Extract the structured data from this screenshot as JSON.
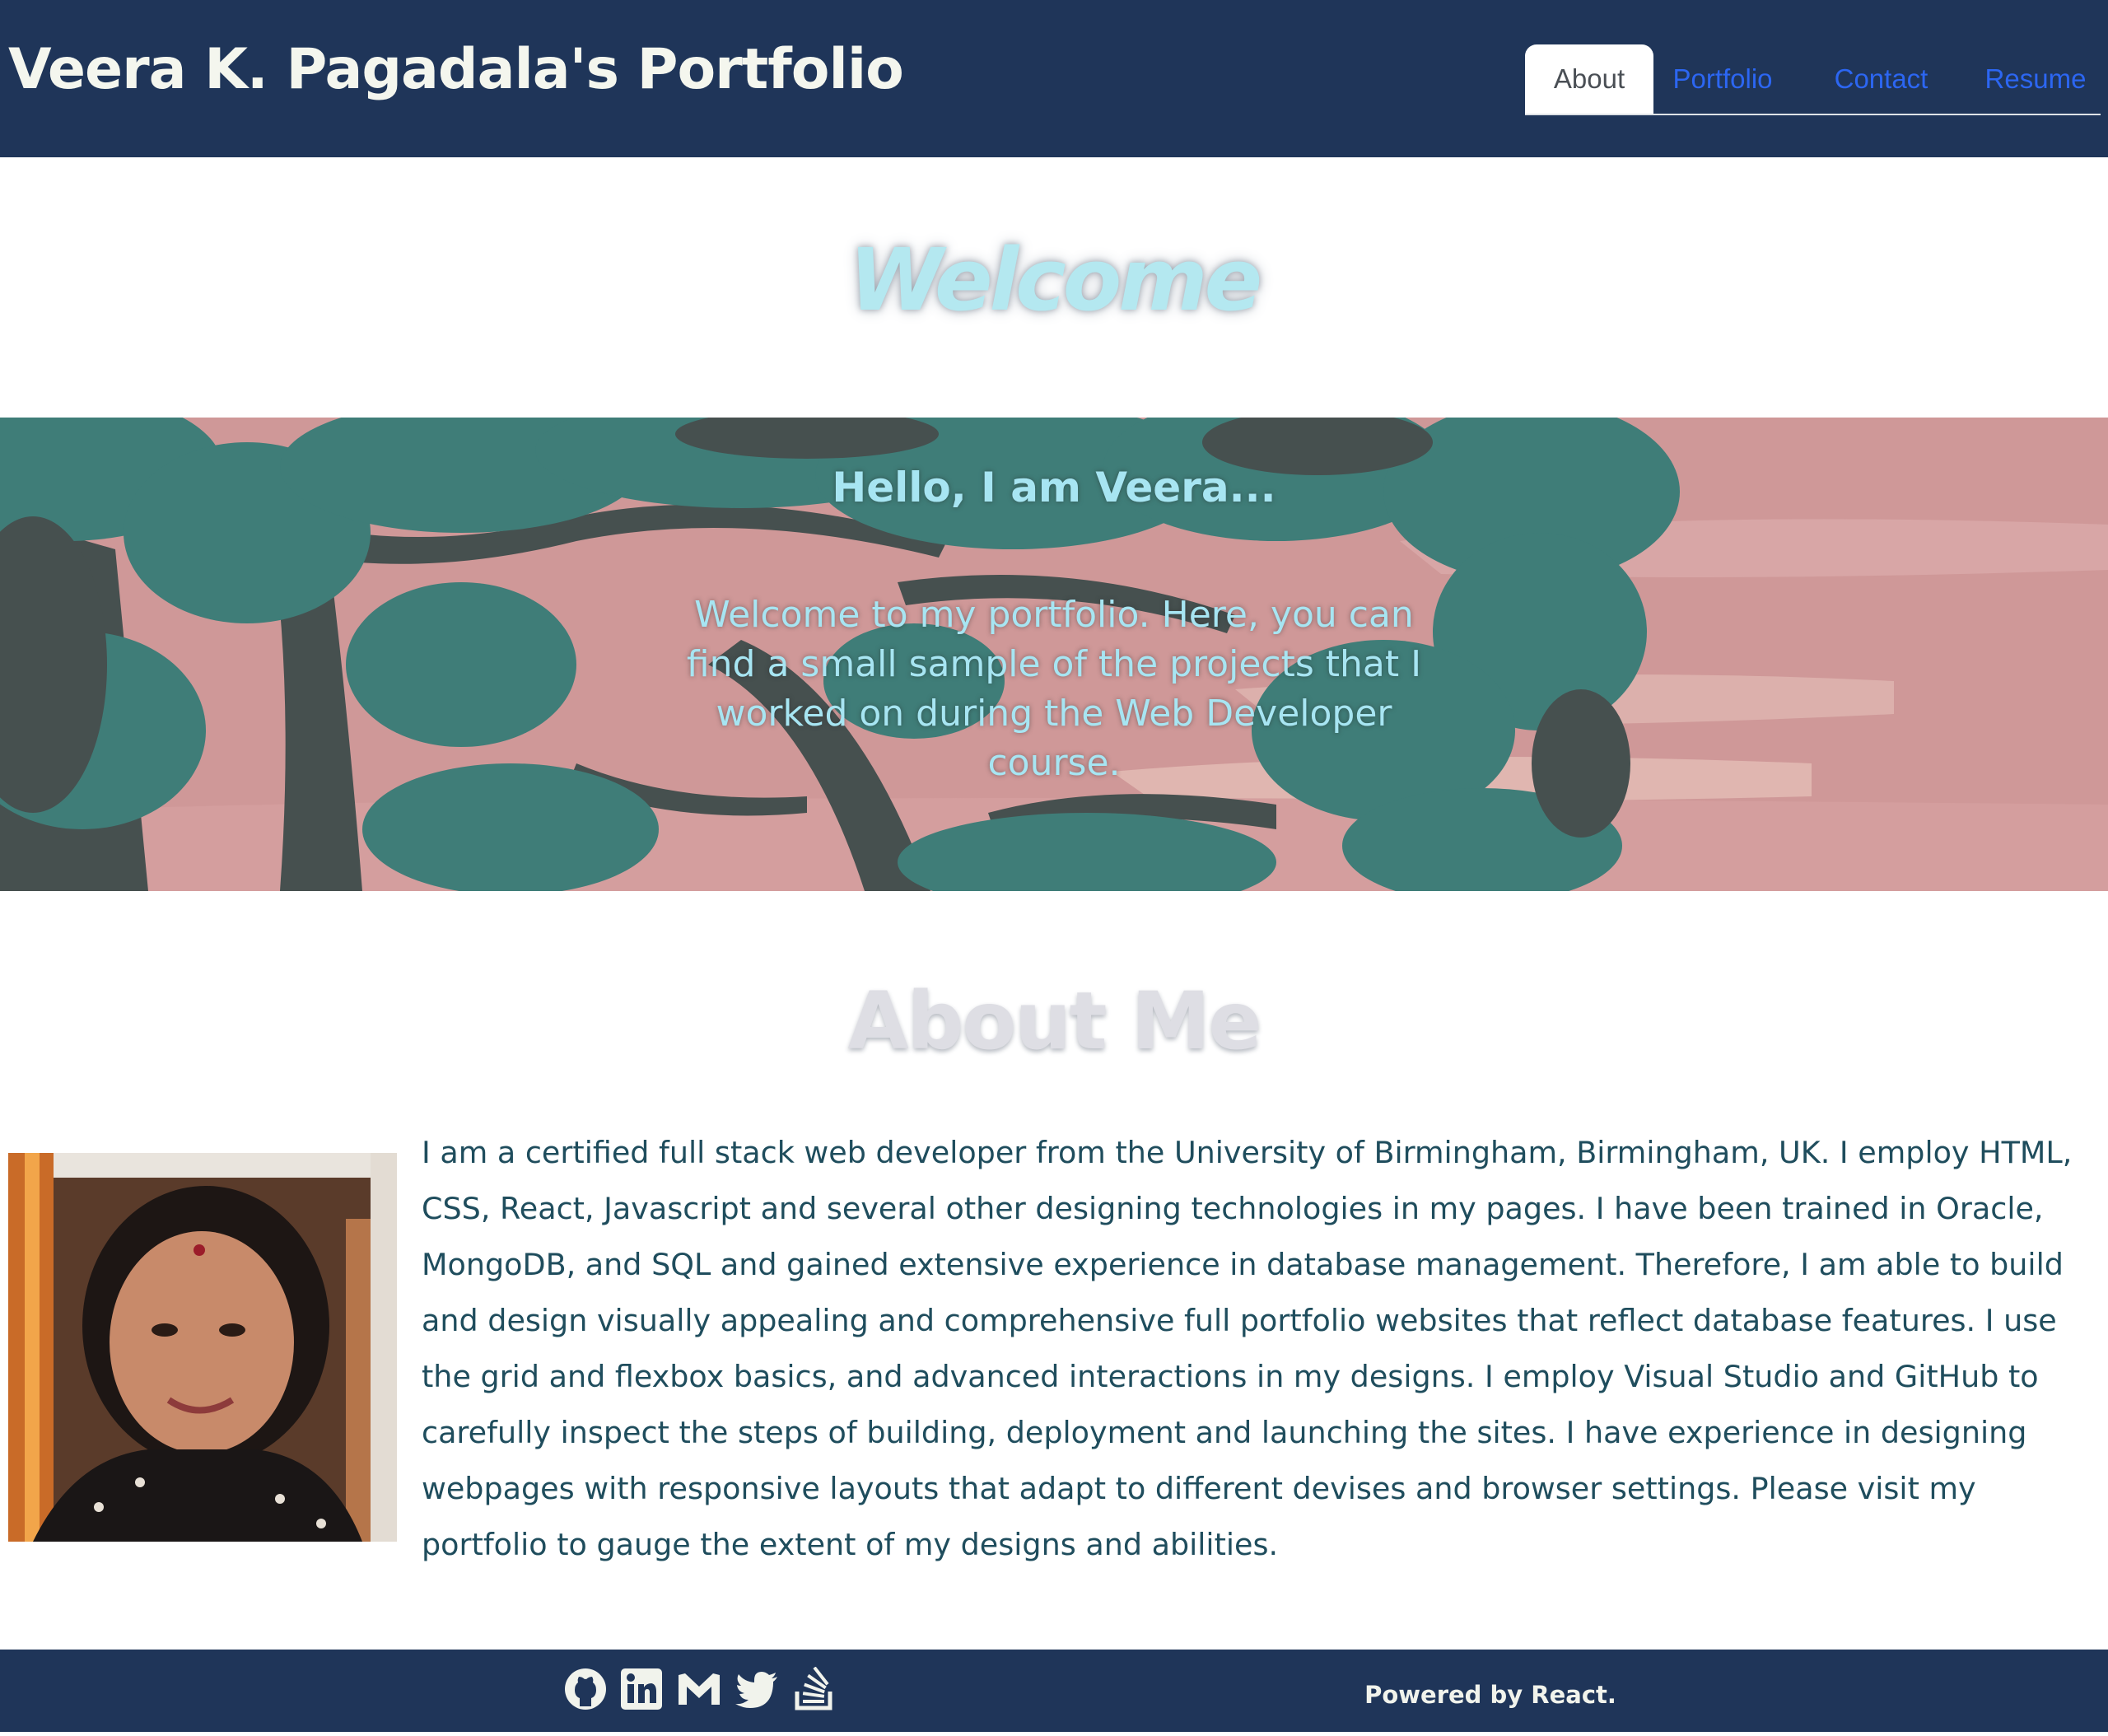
{
  "header": {
    "site_title": "Veera K. Pagadala's Portfolio",
    "nav": {
      "items": [
        {
          "label": "About",
          "active": true
        },
        {
          "label": "Portfolio",
          "active": false
        },
        {
          "label": "Contact",
          "active": false
        },
        {
          "label": "Resume",
          "active": false
        }
      ]
    }
  },
  "welcome": {
    "heading": "Welcome"
  },
  "hero": {
    "greeting": "Hello, I am Veera...",
    "text": "Welcome to my portfolio. Here, you can find a small sample of the projects that I worked on during the Web Developer course."
  },
  "about": {
    "heading": "About Me",
    "bio": "I am a certified full stack web developer from the University of Birmingham, Birmingham, UK. I employ HTML, CSS, React, Javascript and several other designing technologies in my pages. I have been trained in Oracle, MongoDB, and SQL and gained extensive experience in database management. Therefore, I am able to build and design visually appealing and comprehensive full portfolio websites that reflect database features. I use the grid and flexbox basics, and advanced interactions in my designs. I employ Visual Studio and GitHub to carefully inspect the steps of building, deployment and launching the sites. I have experience in designing webpages with responsive layouts that adapt to different devises and browser settings. Please visit my portfolio to gauge the extent of my designs and abilities."
  },
  "footer": {
    "social_icons": [
      "github-icon",
      "linkedin-icon",
      "gmail-icon",
      "twitter-icon",
      "stack-overflow-icon"
    ],
    "powered_by": "Powered by React."
  },
  "colors": {
    "header_bg": "#1f3559",
    "title_text": "#f4f6ee",
    "nav_link": "#2c66f2",
    "accent_cyan": "#a7e5f2",
    "bio_text": "#1f4d5d",
    "hero_sky": "#cf9898",
    "tree_teal": "#3f7d78",
    "tree_dark": "#46504f"
  }
}
